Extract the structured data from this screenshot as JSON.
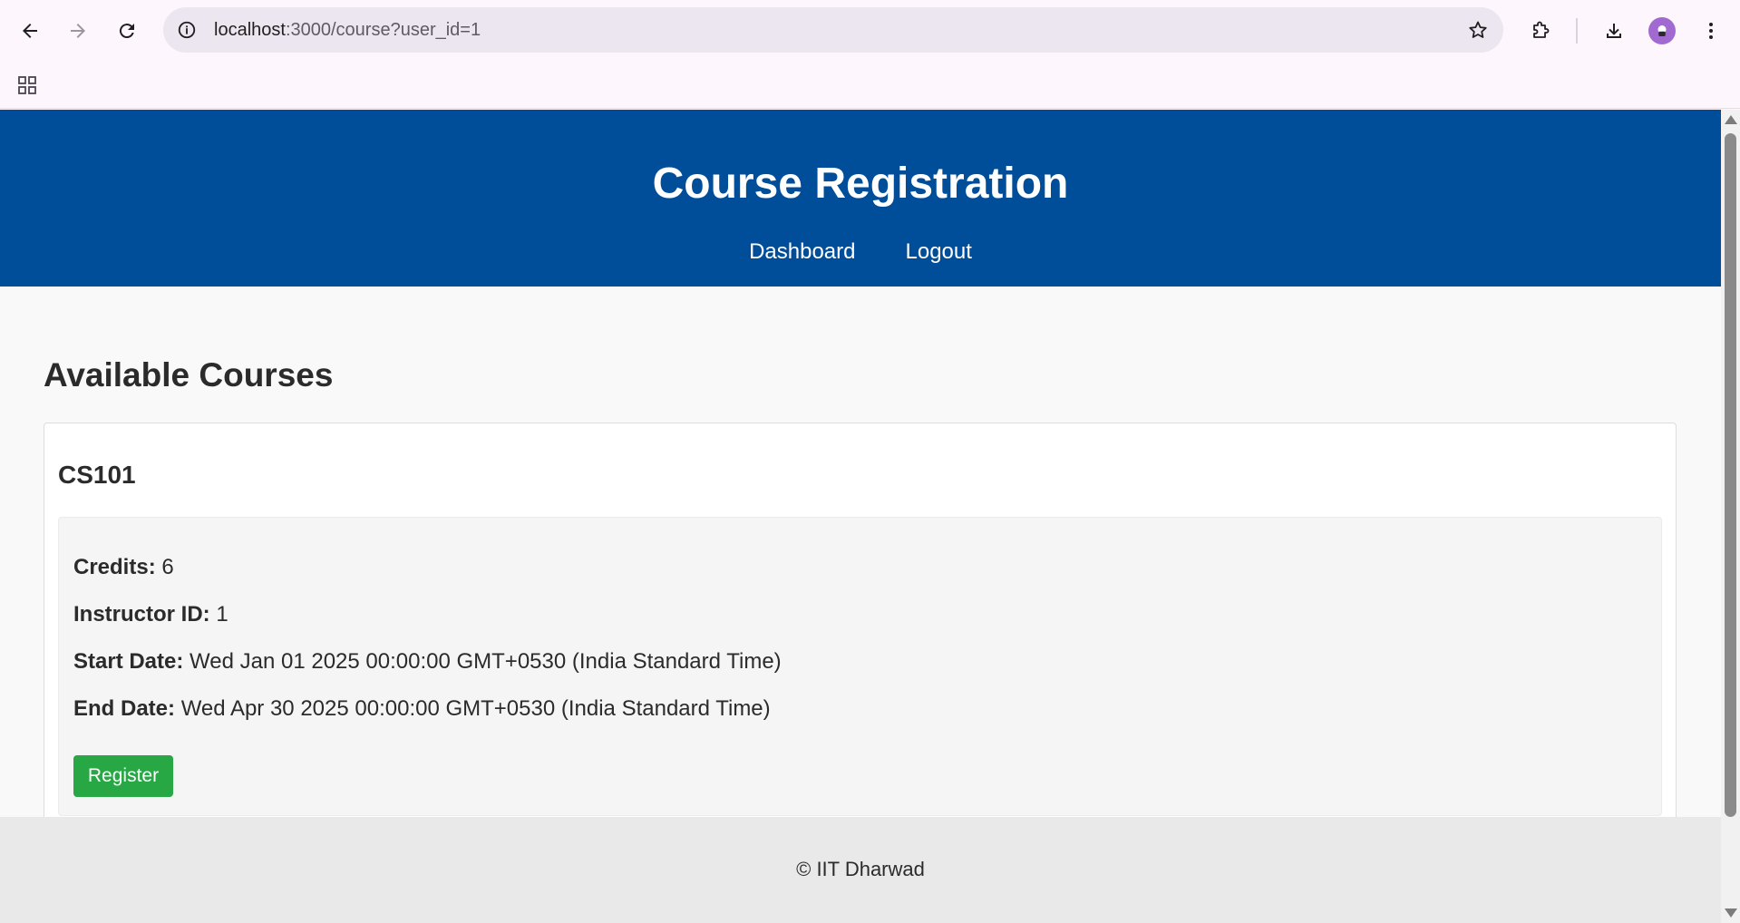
{
  "browser": {
    "url_host": "localhost",
    "url_path": ":3000/course?user_id=1",
    "icons": {
      "back": "arrow-left-icon",
      "forward": "arrow-right-icon",
      "reload": "reload-icon",
      "site_info": "info-icon",
      "bookmark": "star-icon",
      "extensions": "puzzle-icon",
      "downloads": "download-icon",
      "menu": "kebab-menu-icon",
      "apps": "apps-grid-icon"
    }
  },
  "header": {
    "title": "Course Registration",
    "nav": {
      "dashboard": "Dashboard",
      "logout": "Logout"
    },
    "color": "#004e9a"
  },
  "main": {
    "section_title": "Available Courses",
    "course": {
      "code": "CS101",
      "credits_label": "Credits:",
      "credits_value": "6",
      "instructor_label": "Instructor ID:",
      "instructor_value": "1",
      "start_label": "Start Date:",
      "start_value": "Wed Jan 01 2025 00:00:00 GMT+0530 (India Standard Time)",
      "end_label": "End Date:",
      "end_value": "Wed Apr 30 2025 00:00:00 GMT+0530 (India Standard Time)",
      "register_label": "Register",
      "register_color": "#28a745"
    }
  },
  "footer": {
    "text": "© IIT Dharwad"
  }
}
